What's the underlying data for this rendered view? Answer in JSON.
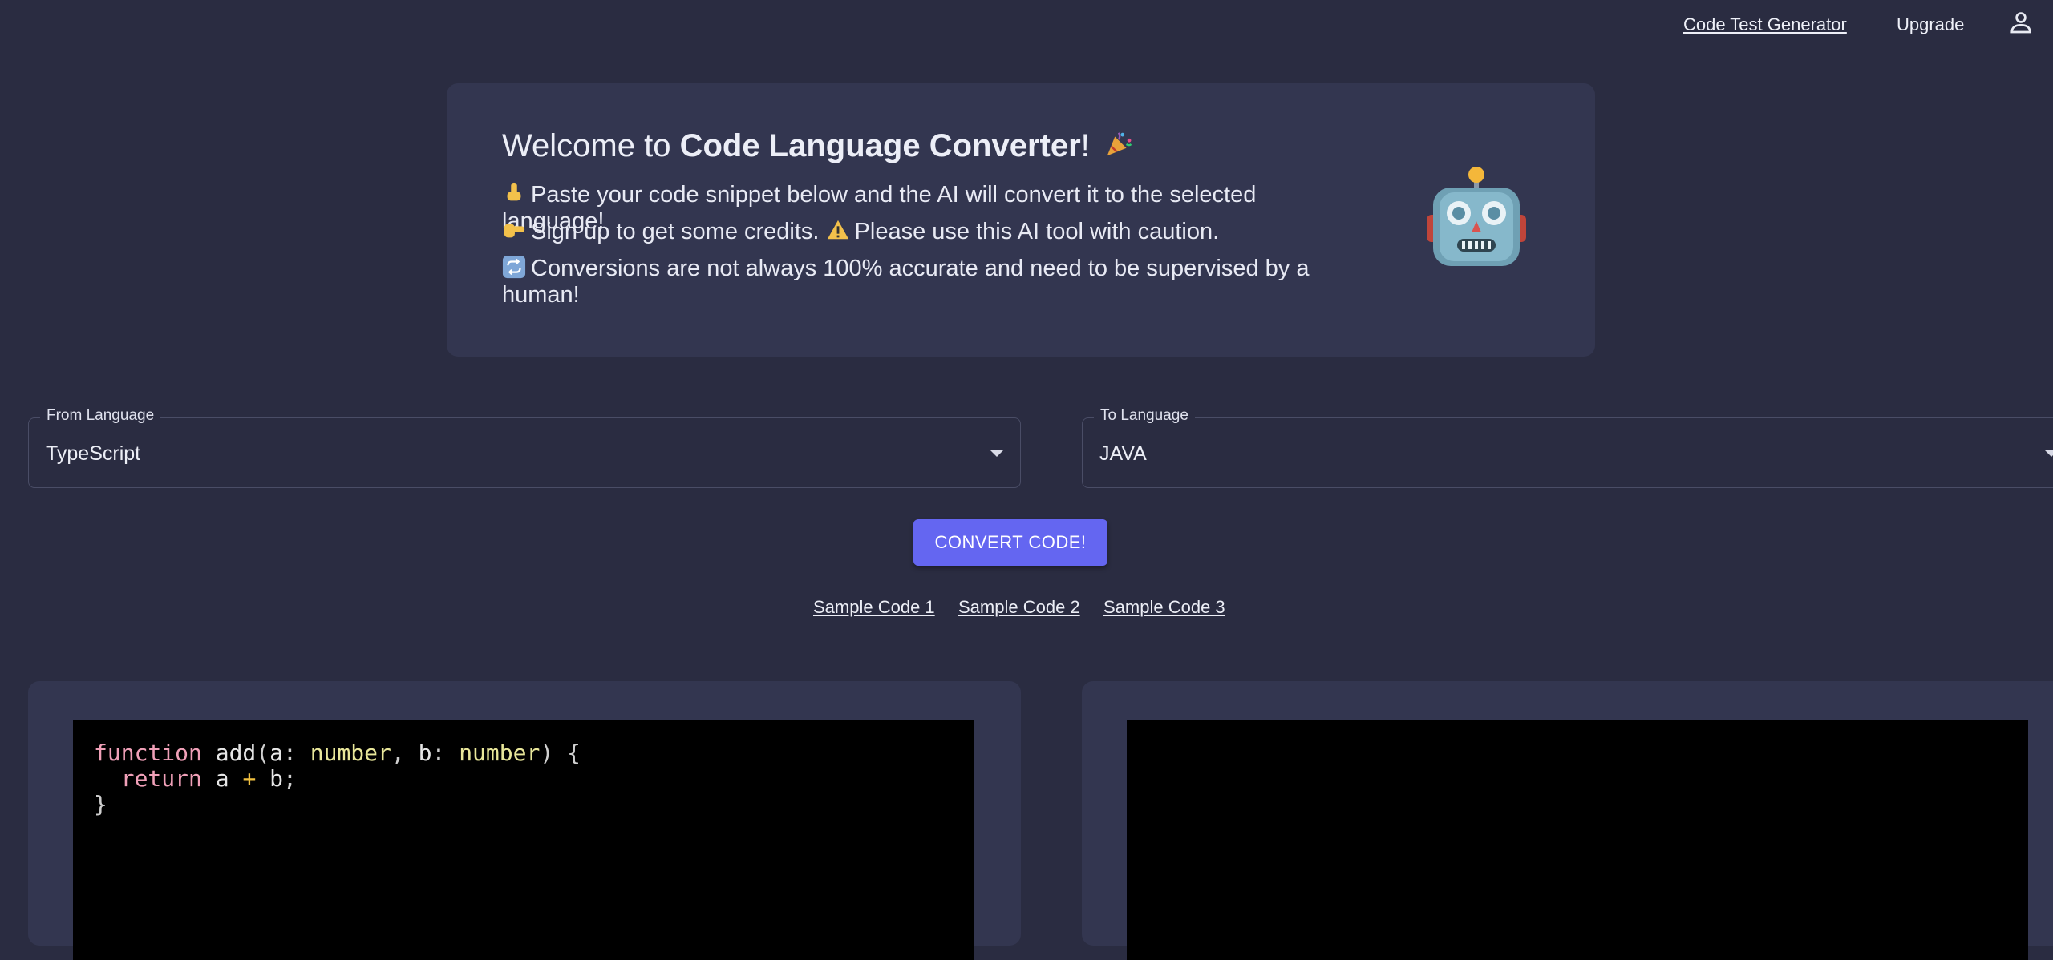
{
  "nav": {
    "code_test_generator": "Code Test Generator",
    "upgrade": "Upgrade",
    "user_icon": "person-outline-icon"
  },
  "welcome": {
    "title_prefix": "Welcome to ",
    "title_bold": "Code Language Converter",
    "title_suffix": "!",
    "title_emoji": "party-popper-icon",
    "line1": "Paste your code snippet below and the AI will convert it to the selected language!",
    "line1_icon": "pointing-down-icon",
    "line2_a": "Sign up to get some credits.",
    "line2_b": "Please use this AI tool with caution.",
    "line2_icon": "pointing-right-icon",
    "line2_warn_icon": "warning-icon",
    "line3": "Conversions are not always 100% accurate and need to be supervised by a human!",
    "line3_icon": "repeat-icon",
    "mascot": "robot-icon"
  },
  "from_language": {
    "label": "From Language",
    "value": "TypeScript"
  },
  "to_language": {
    "label": "To Language",
    "value": "JAVA"
  },
  "convert_button": "CONVERT CODE!",
  "samples": [
    "Sample Code 1",
    "Sample Code 2",
    "Sample Code 3"
  ],
  "input_code": {
    "tokens": [
      "function",
      "add",
      "(",
      "a",
      ":",
      "number",
      ",",
      "b",
      ":",
      "number",
      ")",
      "{",
      "return",
      "a",
      "+",
      "b",
      ";",
      "}"
    ]
  },
  "output_code": ""
}
